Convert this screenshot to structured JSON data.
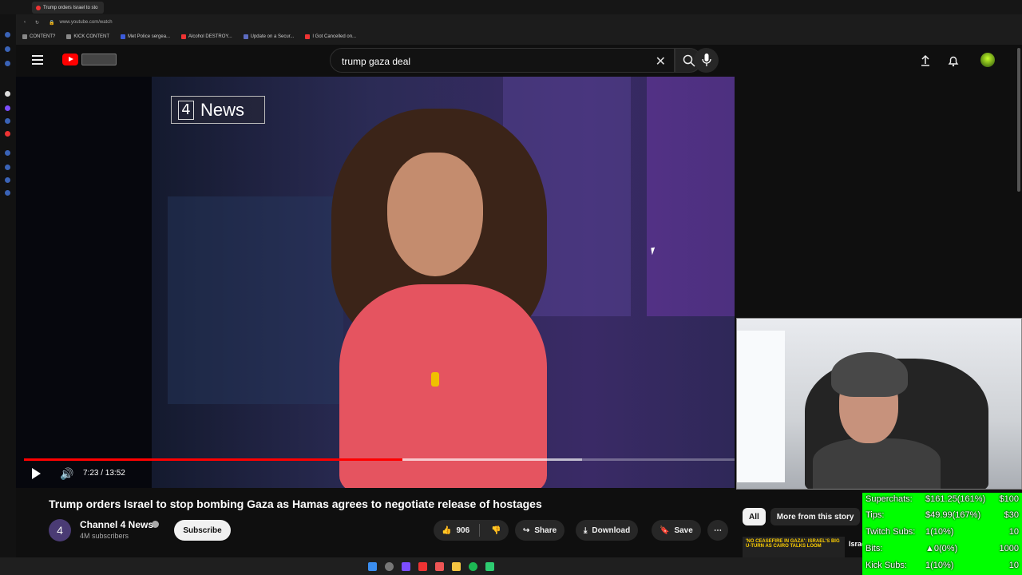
{
  "browser": {
    "tab_title": "Trump orders Israel to sto",
    "url": "www.youtube.com/watch",
    "bookmarks": [
      "CONTENT?",
      "KICK CONTENT",
      "Met Police sergea...",
      "Alcohol DESTROY...",
      "Update on a Secur...",
      "I Got Cancelled on..."
    ]
  },
  "header": {
    "search_query": "trump gaza deal"
  },
  "video": {
    "overlay_logo_text": "News",
    "overlay_logo_number": "4",
    "current_time": "7:23",
    "duration": "13:52",
    "time_display": "7:23 / 13:52",
    "progress_fraction": 0.533,
    "buffer_fraction": 0.785
  },
  "info": {
    "title": "Trump orders Israel to stop bombing Gaza as Hamas agrees to negotiate release of hostages",
    "channel": "Channel 4 News",
    "subscribers": "4M subscribers",
    "subscribe_label": "Subscribe",
    "likes": "906",
    "share_label": "Share",
    "download_label": "Download",
    "save_label": "Save"
  },
  "sidebar": {
    "chips": [
      "All",
      "More from this story"
    ],
    "thumb_text": "'NO CEASEFIRE IN GAZA': ISRAEL'S BIG U-TURN AS CAIRO TALKS LOOM",
    "thumb_side_text": "Israel"
  },
  "stream_stats": {
    "rows": [
      {
        "label": "Superchats:",
        "value": "$161.25(161%)",
        "goal": "$100"
      },
      {
        "label": "Tips:",
        "value": "$49.99(167%)",
        "goal": "$30"
      },
      {
        "label": "Twitch Subs:",
        "value": "1(10%)",
        "goal": "10"
      },
      {
        "label": "Bits:",
        "value": "0(0%)",
        "goal": "1000"
      },
      {
        "label": "Kick Subs:",
        "value": "1(10%)",
        "goal": "10"
      }
    ]
  },
  "colors": {
    "youtube_red": "#ff0000",
    "stats_green": "#00ff00",
    "background": "#0f0f0f"
  }
}
